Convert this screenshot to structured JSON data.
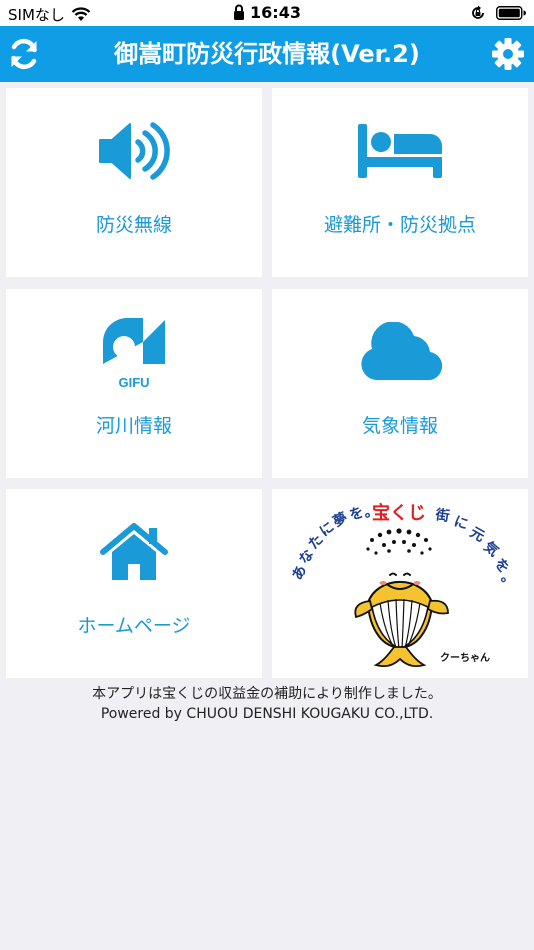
{
  "status_bar": {
    "carrier": "SIMなし",
    "time": "16:43"
  },
  "header": {
    "title": "御嵩町防災行政情報(Ver.2)"
  },
  "tiles": [
    {
      "label": "防災無線",
      "icon": "speaker-icon"
    },
    {
      "label": "避難所・防災拠点",
      "icon": "bed-icon"
    },
    {
      "label": "河川情報",
      "icon": "gifu-logo-icon",
      "logo_text": "GIFU"
    },
    {
      "label": "気象情報",
      "icon": "cloud-icon"
    },
    {
      "label": "ホームページ",
      "icon": "home-icon"
    }
  ],
  "banner": {
    "slogan_left": "あなたに夢を。",
    "brand": "宝くじ",
    "slogan_right": "街に元気を。",
    "mascot_name": "クーちゃん"
  },
  "footer": {
    "line1": "本アプリは宝くじの収益金の補助により制作しました。",
    "line2": "Powered by CHUOU DENSHI KOUGAKU CO.,LTD."
  },
  "colors": {
    "accent": "#0f9ee6",
    "label": "#1a9ad6",
    "background": "#efeff4"
  }
}
